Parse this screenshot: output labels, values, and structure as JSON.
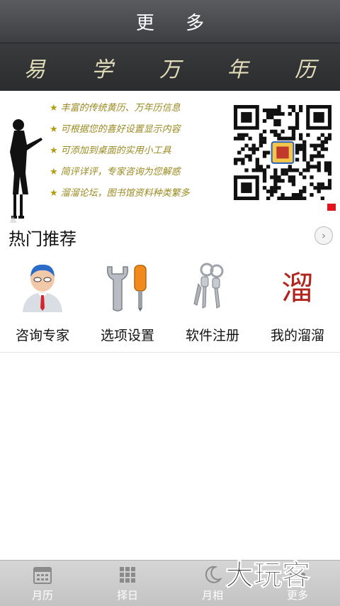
{
  "header": {
    "title": "更 多"
  },
  "brand": {
    "title": "易 学 万 年 历"
  },
  "banner": {
    "features": [
      "丰富的传统黄历、万年历信息",
      "可根据您的喜好设置显示内容",
      "可添加到桌面的实用小工具",
      "简评详评，专家咨询为您解惑",
      "溜溜论坛，图书馆资料种类繁多"
    ],
    "star": "★",
    "active_slide": 1,
    "slide_count": 2,
    "qr_center_icon": "calendar-logo-icon"
  },
  "section": {
    "title": "热门推荐",
    "arrow": "›"
  },
  "recommend": [
    {
      "label": "咨询专家",
      "icon": "expert-avatar-icon"
    },
    {
      "label": "选项设置",
      "icon": "tools-icon"
    },
    {
      "label": "软件注册",
      "icon": "keys-icon"
    },
    {
      "label": "我的溜溜",
      "icon": "liu-seal-icon"
    }
  ],
  "tabs": [
    {
      "label": "月历",
      "icon": "calendar-icon"
    },
    {
      "label": "择日",
      "icon": "grid-dots-icon"
    },
    {
      "label": "月相",
      "icon": "moon-icon"
    },
    {
      "label": "更多",
      "icon": "more-icon",
      "selected": true
    }
  ],
  "watermark": {
    "text": "大玩客"
  },
  "colors": {
    "header": "#3c3e41",
    "brand_text": "#e2dcb8",
    "feature_text": "#9a8a20",
    "active_dot": "#e0141e"
  }
}
